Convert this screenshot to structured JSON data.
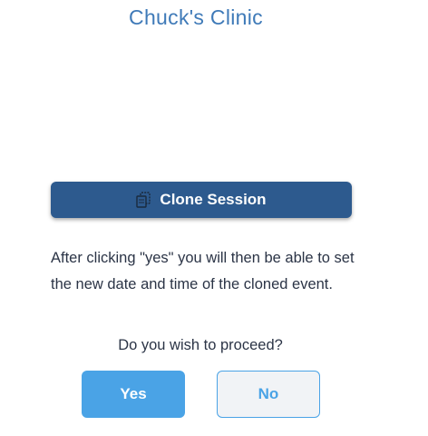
{
  "header": {
    "title": "Chuck's Clinic"
  },
  "clone": {
    "button_label": "Clone Session",
    "icon": "copy-icon"
  },
  "message": {
    "text": "After clicking \"yes\" you will then be able to set the new date and time of the cloned event."
  },
  "confirm": {
    "question": "Do you wish to proceed?",
    "yes_label": "Yes",
    "no_label": "No"
  },
  "colors": {
    "title": "#3f7ab8",
    "clone_button": "#2d5a8e",
    "yes_button": "#4aa3e6",
    "no_button_bg": "#f1f3f6",
    "text": "#2b3446"
  }
}
